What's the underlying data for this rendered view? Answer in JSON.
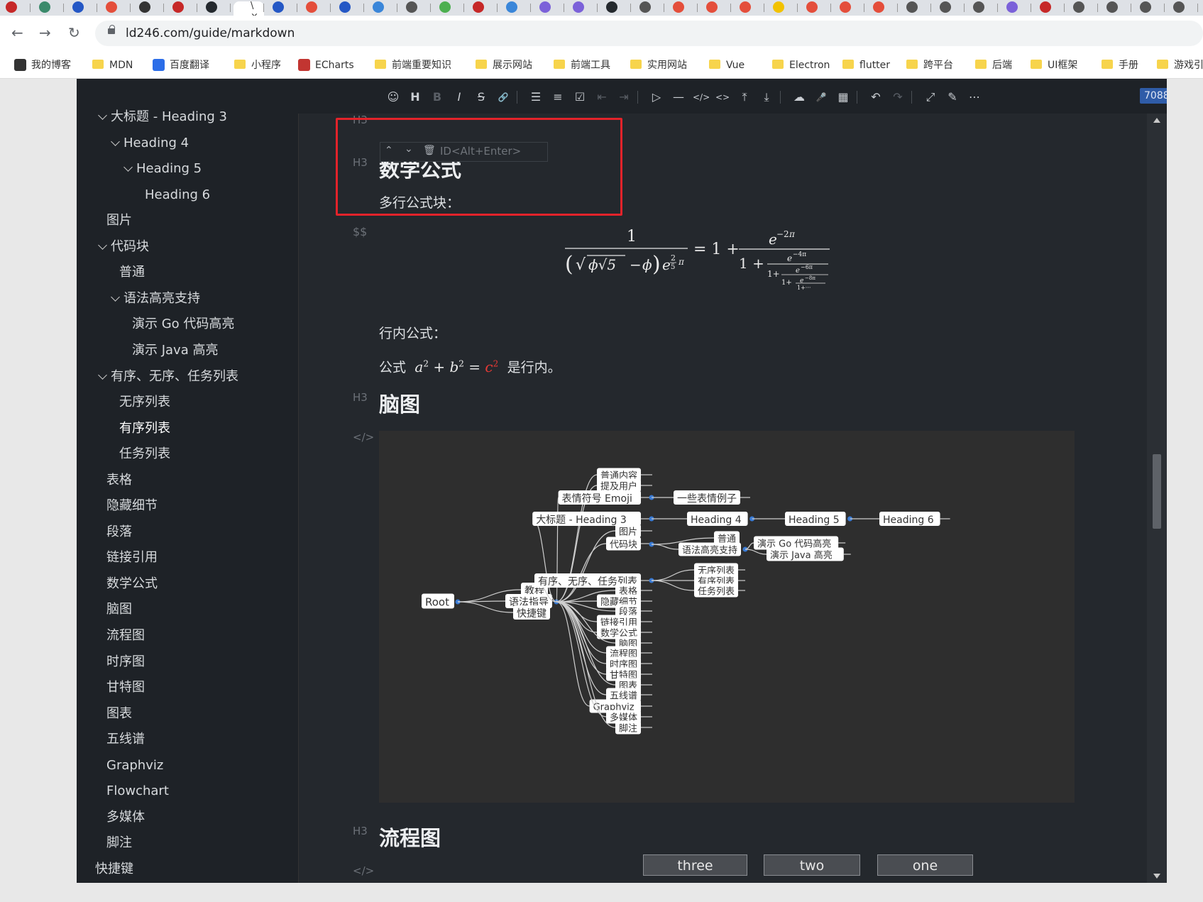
{
  "browser": {
    "tabs": [
      "",
      "",
      "",
      "",
      "",
      "",
      "",
      "\\ ×",
      "",
      "",
      "",
      "",
      "",
      "",
      "",
      "",
      "",
      "",
      "",
      "",
      "",
      "",
      "",
      "",
      "",
      "",
      "",
      "",
      "",
      "",
      "",
      "",
      "",
      "",
      "",
      ""
    ],
    "tab_colors": [
      "#c62828",
      "#3a8a6b",
      "#2457c5",
      "#e44e3b",
      "#333",
      "#c62828",
      "#24292e",
      "#ffffff",
      "#2457c5",
      "#e44e3b",
      "#2457c5",
      "#3a86d9",
      "#555",
      "#4caf50",
      "#c62828",
      "#3a86d9",
      "#7b61d9",
      "#7b61d9",
      "#24292e",
      "#555",
      "#e44e3b",
      "#e44e3b",
      "#e44e3b",
      "#f2c200",
      "#e44e3b",
      "#e44e3b",
      "#e44e3b",
      "#555",
      "#555",
      "#555",
      "#7b61d9",
      "#c62828",
      "#555",
      "#555",
      "#555",
      "#555"
    ],
    "url": "ld246.com/guide/markdown",
    "nav": {
      "back": "←",
      "forward": "→",
      "reload": "↻"
    },
    "bookmarks": [
      {
        "label": "我的博客",
        "icon": "user-icon",
        "color": "#333"
      },
      {
        "label": "MDN",
        "icon": "folder-icon",
        "color": "#f7d44c"
      },
      {
        "label": "百度翻译",
        "icon": "translate-icon",
        "color": "#2b6de8"
      },
      {
        "label": "小程序",
        "icon": "folder-icon",
        "color": "#f7d44c"
      },
      {
        "label": "ECharts",
        "icon": "echarts-icon",
        "color": "#c23531"
      },
      {
        "label": "前端重要知识",
        "icon": "folder-icon",
        "color": "#f7d44c"
      },
      {
        "label": "展示网站",
        "icon": "folder-icon",
        "color": "#f7d44c"
      },
      {
        "label": "前端工具",
        "icon": "folder-icon",
        "color": "#f7d44c"
      },
      {
        "label": "实用网站",
        "icon": "folder-icon",
        "color": "#f7d44c"
      },
      {
        "label": "Vue",
        "icon": "folder-icon",
        "color": "#f7d44c"
      },
      {
        "label": "Electron",
        "icon": "folder-icon",
        "color": "#f7d44c"
      },
      {
        "label": "flutter",
        "icon": "folder-icon",
        "color": "#f7d44c"
      },
      {
        "label": "跨平台",
        "icon": "folder-icon",
        "color": "#f7d44c"
      },
      {
        "label": "后端",
        "icon": "folder-icon",
        "color": "#f7d44c"
      },
      {
        "label": "UI框架",
        "icon": "folder-icon",
        "color": "#f7d44c"
      },
      {
        "label": "手册",
        "icon": "folder-icon",
        "color": "#f7d44c"
      },
      {
        "label": "游戏引",
        "icon": "folder-icon",
        "color": "#f7d44c"
      }
    ]
  },
  "toolbar": {
    "buttons": [
      {
        "name": "emoji-icon",
        "glyph": "☺"
      },
      {
        "name": "heading-icon",
        "glyph": "H"
      },
      {
        "name": "bold-icon",
        "glyph": "B"
      },
      {
        "name": "italic-icon",
        "glyph": "I"
      },
      {
        "name": "strike-icon",
        "glyph": "S"
      },
      {
        "name": "link-icon",
        "glyph": "🔗"
      },
      {
        "name": "unordered-list-icon",
        "glyph": "☰"
      },
      {
        "name": "ordered-list-icon",
        "glyph": "≡"
      },
      {
        "name": "check-icon",
        "glyph": "☑"
      },
      {
        "name": "outdent-icon",
        "glyph": "⇤"
      },
      {
        "name": "indent-icon",
        "glyph": "⇥"
      },
      {
        "name": "quote-icon",
        "glyph": "▷"
      },
      {
        "name": "line-icon",
        "glyph": "—"
      },
      {
        "name": "code-icon",
        "glyph": "</>"
      },
      {
        "name": "inline-code-icon",
        "glyph": "<>"
      },
      {
        "name": "insert-before-icon",
        "glyph": "⤒"
      },
      {
        "name": "insert-after-icon",
        "glyph": "⤓"
      },
      {
        "name": "upload-icon",
        "glyph": "☁"
      },
      {
        "name": "record-icon",
        "glyph": "🎤"
      },
      {
        "name": "table-icon",
        "glyph": "▦"
      },
      {
        "name": "undo-icon",
        "glyph": "↶"
      },
      {
        "name": "redo-icon",
        "glyph": "↷"
      },
      {
        "name": "fullscreen-icon",
        "glyph": "⤢"
      },
      {
        "name": "edit-mode-icon",
        "glyph": "✎"
      },
      {
        "name": "more-icon",
        "glyph": "⋯"
      }
    ],
    "word_count": "7088"
  },
  "outline": [
    {
      "label": "大标题 - Heading 3",
      "level": 1,
      "chevron": true
    },
    {
      "label": "Heading 4",
      "level": 2,
      "chevron": true
    },
    {
      "label": "Heading 5",
      "level": 3,
      "chevron": true
    },
    {
      "label": "Heading 6",
      "level": 4,
      "chevron": false
    },
    {
      "label": "图片",
      "level": 1,
      "chevron": false
    },
    {
      "label": "代码块",
      "level": 1,
      "chevron": true
    },
    {
      "label": "普通",
      "level": 2,
      "chevron": false
    },
    {
      "label": "语法高亮支持",
      "level": 2,
      "chevron": true
    },
    {
      "label": "演示 Go 代码高亮",
      "level": 3,
      "chevron": false
    },
    {
      "label": "演示 Java 高亮",
      "level": 3,
      "chevron": false
    },
    {
      "label": "有序、无序、任务列表",
      "level": 1,
      "chevron": true
    },
    {
      "label": "无序列表",
      "level": 2,
      "chevron": false
    },
    {
      "label": "有序列表",
      "level": 2,
      "chevron": false,
      "current": true
    },
    {
      "label": "任务列表",
      "level": 2,
      "chevron": false
    },
    {
      "label": "表格",
      "level": 1,
      "chevron": false
    },
    {
      "label": "隐藏细节",
      "level": 1,
      "chevron": false
    },
    {
      "label": "段落",
      "level": 1,
      "chevron": false
    },
    {
      "label": "链接引用",
      "level": 1,
      "chevron": false
    },
    {
      "label": "数学公式",
      "level": 1,
      "chevron": false
    },
    {
      "label": "脑图",
      "level": 1,
      "chevron": false
    },
    {
      "label": "流程图",
      "level": 1,
      "chevron": false
    },
    {
      "label": "时序图",
      "level": 1,
      "chevron": false
    },
    {
      "label": "甘特图",
      "level": 1,
      "chevron": false
    },
    {
      "label": "图表",
      "level": 1,
      "chevron": false
    },
    {
      "label": "五线谱",
      "level": 1,
      "chevron": false
    },
    {
      "label": "Graphviz",
      "level": 1,
      "chevron": false
    },
    {
      "label": "Flowchart",
      "level": 1,
      "chevron": false
    },
    {
      "label": "多媒体",
      "level": 1,
      "chevron": false
    },
    {
      "label": "脚注",
      "level": 1,
      "chevron": false
    },
    {
      "label": "快捷键",
      "level": 0,
      "chevron": false
    }
  ],
  "editor": {
    "marks": {
      "h3": "H3",
      "math": "$$",
      "code": "</>"
    },
    "block_toolbar": {
      "up": "^",
      "down": "v",
      "delete": "🗑",
      "id_placeholder": "ID<Alt+Enter>"
    },
    "math_heading": "数学公式",
    "multiline_label": "多行公式块：",
    "inline_label": "行内公式：",
    "inline_before": "公式",
    "inline_after": "是行内。",
    "inline_highlight_color": "#e53935",
    "mindmap_heading": "脑图",
    "flowchart_heading": "流程图",
    "flow_boxes": [
      "three",
      "two",
      "one"
    ]
  },
  "mindmap": {
    "root": "Root",
    "level1": [
      "教程",
      "语法指导",
      "快捷键"
    ],
    "syntax_children": [
      "普通内容",
      "提及用户",
      "表情符号 Emoji",
      "大标题 - Heading 3",
      "图片",
      "代码块",
      "有序、无序、任务列表",
      "表格",
      "隐藏细节",
      "段落",
      "链接引用",
      "数学公式",
      "脑图",
      "流程图",
      "时序图",
      "甘特图",
      "图表",
      "五线谱",
      "Graphviz",
      "多媒体",
      "脚注"
    ],
    "emoji_child": "一些表情例子",
    "heading_chain": [
      "Heading 4",
      "Heading 5",
      "Heading 6"
    ],
    "code_children": [
      "普通",
      "语法高亮支持"
    ],
    "highlight_children": [
      "演示 Go 代码高亮",
      "演示 Java 高亮"
    ],
    "list_children": [
      "无序列表",
      "有序列表",
      "任务列表"
    ],
    "node_fill": "#ffffff",
    "link_color": "#cfcfcf",
    "dot_color": "#3a7bd5"
  }
}
